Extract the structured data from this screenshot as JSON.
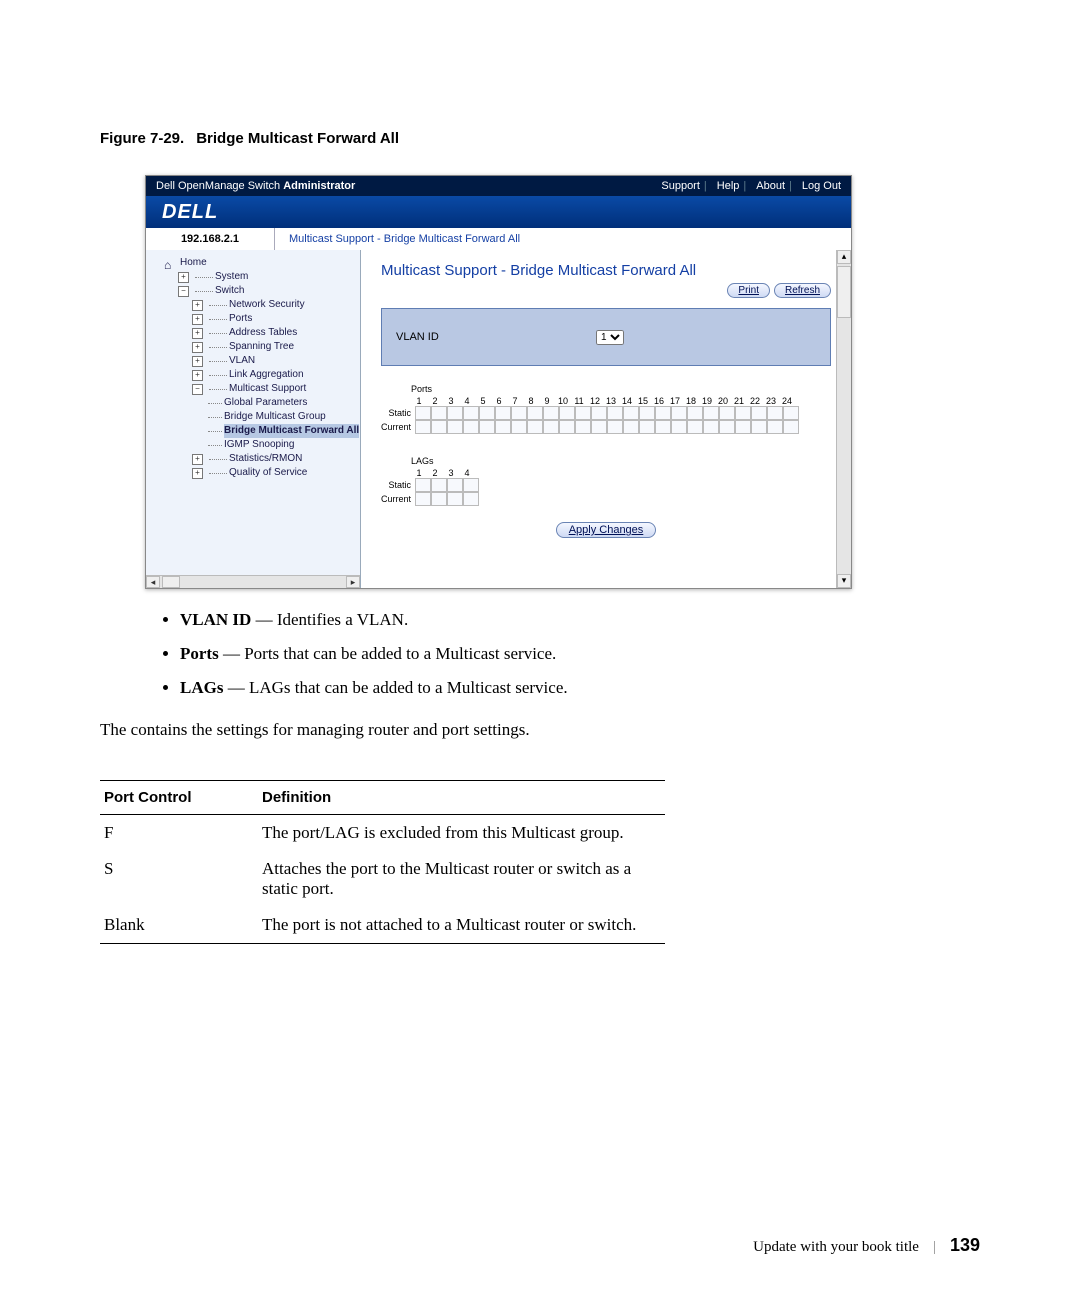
{
  "figure": {
    "label": "Figure 7-29.",
    "title": "Bridge Multicast Forward All"
  },
  "topbar": {
    "app_title_pre": "Dell OpenManage Switch ",
    "app_title_bold": "Administrator",
    "links": {
      "support": "Support",
      "help": "Help",
      "about": "About",
      "logout": "Log Out"
    }
  },
  "logo_text": "DELL",
  "ip": "192.168.2.1",
  "breadcrumb": "Multicast Support - Bridge Multicast Forward All",
  "nav": {
    "home": "Home",
    "items": [
      "System",
      "Switch",
      "Network Security",
      "Ports",
      "Address Tables",
      "Spanning Tree",
      "VLAN",
      "Link Aggregation",
      "Multicast Support",
      "Global Parameters",
      "Bridge Multicast Group",
      "Bridge Multicast Forward All",
      "IGMP Snooping",
      "Statistics/RMON",
      "Quality of Service"
    ]
  },
  "panel": {
    "title": "Multicast Support - Bridge Multicast Forward All",
    "print": "Print",
    "refresh": "Refresh",
    "vlan_label": "VLAN ID",
    "vlan_value": "1",
    "ports_label": "Ports",
    "port_numbers": [
      "1",
      "2",
      "3",
      "4",
      "5",
      "6",
      "7",
      "8",
      "9",
      "10",
      "11",
      "12",
      "13",
      "14",
      "15",
      "16",
      "17",
      "18",
      "19",
      "20",
      "21",
      "22",
      "23",
      "24"
    ],
    "lags_label": "LAGs",
    "lag_numbers": [
      "1",
      "2",
      "3",
      "4"
    ],
    "row_static": "Static",
    "row_current": "Current",
    "apply": "Apply Changes"
  },
  "bullets": [
    {
      "term": "VLAN ID",
      "desc": " — Identifies a VLAN."
    },
    {
      "term": "Ports",
      "desc": " — Ports that can be added to a Multicast service."
    },
    {
      "term": "LAGs",
      "desc": " — LAGs that can be added to a Multicast service."
    }
  ],
  "paragraph": "The  contains the settings for managing router and port settings.",
  "def_headers": {
    "c1": "Port Control",
    "c2": "Definition"
  },
  "defs": [
    {
      "c1": "F",
      "c2": "The port/LAG is excluded from this Multicast group."
    },
    {
      "c1": "S",
      "c2": "Attaches the port to the Multicast router or switch as a static port."
    },
    {
      "c1": "Blank",
      "c2": "The port is not attached to a Multicast router or switch."
    }
  ],
  "footer": {
    "title": "Update with your book title",
    "page": "139"
  }
}
